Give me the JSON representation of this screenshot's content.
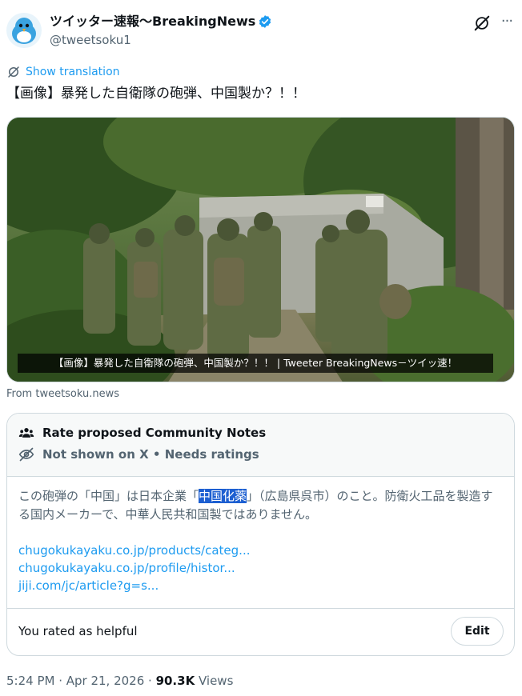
{
  "author": {
    "name": "ツイッター速報〜BreakingNews",
    "handle": "@tweetsoku1",
    "verified": true,
    "avatar_icon": "bird-avatar-icon"
  },
  "actions": {
    "grok_icon": "grok-icon",
    "more_icon": "more-icon",
    "more_label": "···"
  },
  "translation": {
    "label": "Show translation",
    "icon": "translate-icon"
  },
  "tweet": {
    "text": "【画像】暴発した自衛隊の砲弾、中国製か？！！",
    "card_caption": "【画像】暴発した自衛隊の砲弾、中国製か？！！ | Tweeter BreakingNews－ツイッ速！",
    "source": "From tweetsoku.news"
  },
  "community_notes": {
    "header_title": "Rate proposed Community Notes",
    "status": "Not shown on X • Needs ratings",
    "note_before": "この砲弾の「中国」は日本企業「",
    "note_highlight": "中国化薬",
    "note_after": "」（広島県呉市）のこと。防衛火工品を製造する国内メーカーで、中華人民共和国製ではありません。",
    "links": [
      "chugokukayaku.co.jp/products/categ...",
      "chugokukayaku.co.jp/profile/histor...",
      "jiji.com/jc/article?g=s..."
    ],
    "rated_text": "You rated as helpful",
    "edit_label": "Edit"
  },
  "meta": {
    "time": "5:24 PM · Apr 21, 2026 · ",
    "views_count": "90.3K",
    "views_label": " Views"
  },
  "colors": {
    "accent": "#1d9bf0",
    "text": "#0f1419",
    "muted": "#536471",
    "border": "#cfd9de",
    "highlight": "#1d5fd1"
  }
}
